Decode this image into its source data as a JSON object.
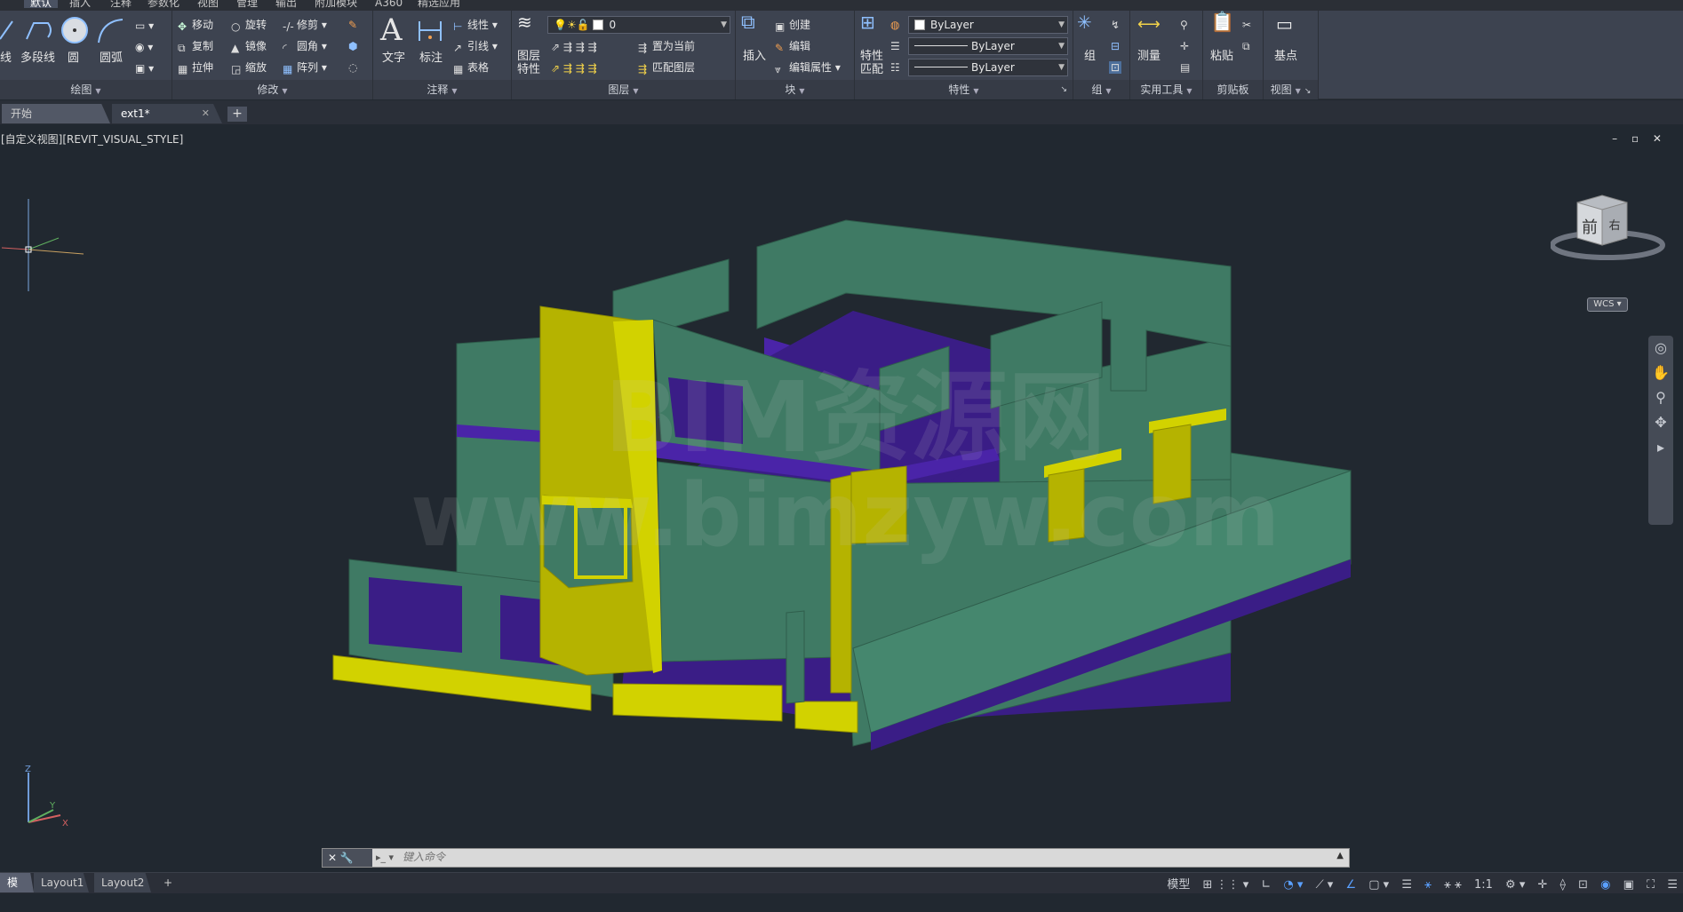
{
  "menu": {
    "tabs": [
      "默认",
      "插入",
      "注释",
      "参数化",
      "视图",
      "管理",
      "输出",
      "附加模块",
      "A360",
      "精选应用"
    ],
    "active": "默认"
  },
  "ribbon": {
    "draw": {
      "title": "绘图",
      "line": "线",
      "polyline": "多段线",
      "circle": "圆",
      "arc": "圆弧"
    },
    "modify": {
      "title": "修改",
      "move": "移动",
      "rotate": "旋转",
      "trim": "修剪",
      "copy": "复制",
      "mirror": "镜像",
      "fillet": "圆角",
      "stretch": "拉伸",
      "scale": "缩放",
      "array": "阵列"
    },
    "annotation": {
      "title": "注释",
      "text": "文字",
      "dimension": "标注",
      "linear": "线性",
      "leader": "引线",
      "table": "表格"
    },
    "layers": {
      "title": "图层",
      "props": "图层\n特性",
      "layer_value": "0",
      "make_current": "置为当前",
      "match_layer": "匹配图层"
    },
    "block": {
      "title": "块",
      "insert": "插入",
      "create": "创建",
      "edit": "编辑",
      "edit_attr": "编辑属性"
    },
    "properties": {
      "title": "特性",
      "match": "特性\n匹配",
      "color": "ByLayer",
      "linetype": "ByLayer",
      "lineweight": "ByLayer"
    },
    "groups": {
      "title": "组",
      "group": "组"
    },
    "utilities": {
      "title": "实用工具",
      "measure": "测量"
    },
    "clipboard": {
      "title": "剪贴板",
      "paste": "粘贴"
    },
    "view": {
      "title": "视图",
      "basepoint": "基点"
    }
  },
  "tabs": {
    "start": "开始",
    "file": "ext1*",
    "new": "+"
  },
  "viewport": {
    "label": "[自定义视图][REVIT_VISUAL_STYLE]",
    "controls": "– ▫ ✕",
    "viewcube_front": "前",
    "viewcube_right": "右",
    "wcs": "WCS",
    "watermark_1": "BIM资源网",
    "watermark_2": "www.bimzyw.com",
    "ucs_z": "Z",
    "ucs_x": "X",
    "ucs_y": "Y"
  },
  "commandline": {
    "placeholder": "键入命令",
    "icons": "✕ 🔧"
  },
  "status": {
    "layouts": [
      "模型",
      "Layout1",
      "Layout2",
      "+"
    ],
    "model": "模型",
    "scale": "1:1"
  },
  "colors": {
    "wall": "#3f7a64",
    "wall_dark": "#2f5e4c",
    "slab": "#3a1d86",
    "accent": "#b5b300"
  }
}
